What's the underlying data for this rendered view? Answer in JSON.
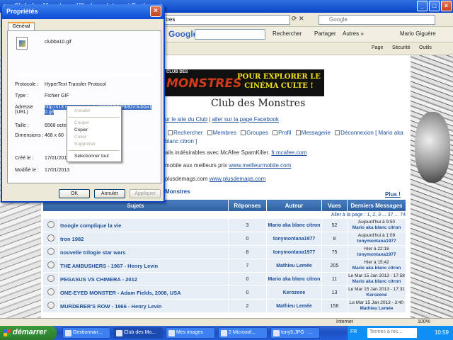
{
  "browser": {
    "title": "Club des Monstres - Windows Internet Explorer",
    "address_partial": "tres",
    "search_placeholder": "Google",
    "google_toolbar": {
      "logo": "Google",
      "search_btn": "Rechercher",
      "share_btn": "Partager",
      "more_btn": "Autres »",
      "user": "Mario Giguère"
    },
    "command_bar": {
      "page": "Page",
      "security": "Sécurité",
      "tools": "Outils"
    }
  },
  "dialog": {
    "title": "Propriétés",
    "tab": "Général",
    "filename": "clubba10.gif",
    "protocol_label": "Protocole :",
    "protocol_value": "HyperText Transfer Protocol",
    "type_label": "Type :",
    "type_value": "Fichier GIF",
    "address_label": "Adresse (URL)",
    "address_value_1": "http://i13.servimg.com/u/f13/09/02/69/82/clubba1",
    "address_value_2": "0.gif",
    "size_label": "Taille :",
    "size_value": "6568 octet",
    "dimensions_label": "Dimensions :",
    "dimensions_value": "468 x 60",
    "created_label": "Créé le :",
    "created_value": "17/01/201",
    "modified_label": "Modifié le :",
    "modified_value": "17/01/2013",
    "ok": "OK",
    "cancel": "Annuler",
    "apply": "Appliquer"
  },
  "context_menu": {
    "items": [
      "Annuler",
      "Couper",
      "Copier",
      "Coller",
      "Supprimer",
      "Sélectionner tout"
    ]
  },
  "forum": {
    "banner_small": "CLUB DES",
    "banner_big": "MONSTRES",
    "banner_tag": "POUR EXPLORER LE CINÉMA CULTE !",
    "title": "Club des Monstres",
    "links_prefix": "ur le site du Club",
    "links_sep": "|",
    "links_fb": "aller sur la page Facebook",
    "nav": [
      "Rechercher",
      "Membres",
      "Groupes",
      "Profil",
      "Messagerie",
      "Déconnexion [ Mario aka blanc citron ]"
    ],
    "ad1_text": "ails indésirables avec McAfee SpamKiller.",
    "ad1_link": "fr.mcafee.com",
    "ad2_text": "mobile aux meilleurs prix",
    "ad2_link": "www.meilleurmobile.com",
    "ad3_text": "plusdemags.com",
    "ad3_link": "www.plusdemags.com",
    "section": "Monstres",
    "plus": "Plus !",
    "pager": "Aller à la page : 1, 2, 3 ... 37 ... 74",
    "headers": [
      "Sujets",
      "Réponses",
      "Auteur",
      "Vues",
      "Derniers Messages"
    ],
    "rows": [
      {
        "subject": "Google complique la vie",
        "replies": "3",
        "author": "Mario aka blanc citron",
        "views": "52",
        "last1": "Aujourd'hui à 9:50",
        "last2": "Mario aka blanc citron"
      },
      {
        "subject": "tron 1982",
        "replies": "0",
        "author": "tonymontana1977",
        "views": "8",
        "last1": "Aujourd'hui à 1:09",
        "last2": "tonymontana1977"
      },
      {
        "subject": "nouvelle trilogie star wars",
        "replies": "8",
        "author": "tonymontana1977",
        "views": "75",
        "last1": "Hier à 22:16",
        "last2": "tonymontana1977"
      },
      {
        "subject": "THE AMBUSHERS - 1967 - Henry Levin",
        "replies": "7",
        "author": "Mathieu Lemée",
        "views": "205",
        "last1": "Hier à 15:42",
        "last2": "Mario aka blanc citron"
      },
      {
        "subject": "PEGASUS VS CHIMERA - 2012",
        "replies": "0",
        "author": "Mario aka blanc citron",
        "views": "11",
        "last1": "Le Mar 15 Jan 2013 - 17:58",
        "last2": "Mario aka blanc citron"
      },
      {
        "subject": "ONE-EYED MONSTER - Adam Fields, 2008, USA",
        "replies": "0",
        "author": "Kerozene",
        "views": "13",
        "last1": "Le Mar 15 Jan 2013 - 17:31",
        "last2": "Kerozene"
      },
      {
        "subject": "MURDERER'S ROW - 1966 - Henry Levin",
        "replies": "2",
        "author": "Mathieu Lemée",
        "views": "156",
        "last1": "Le Mar 15 Jan 2013 - 3:40",
        "last2": "Mathieu Lemée"
      }
    ]
  },
  "statusbar": {
    "zone": "Internet",
    "zoom": "100%"
  },
  "taskbar": {
    "start": "démarrer",
    "tasks": [
      "Gestionnair...",
      "Club des Mo...",
      "Mes images",
      "2 Microsof...",
      "tony5.JPG - ..."
    ],
    "lang": "FR",
    "search_placeholder": "Termes à rec...",
    "clock": "10:59"
  }
}
